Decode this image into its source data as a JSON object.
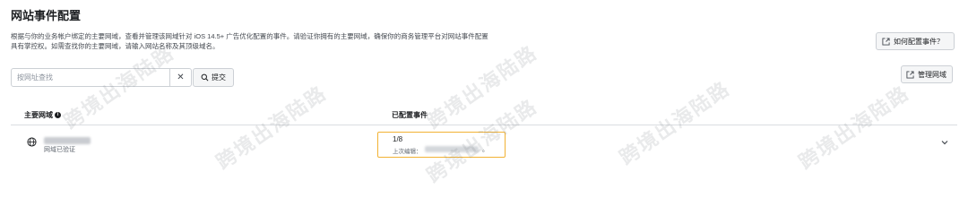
{
  "page": {
    "title": "网站事件配置",
    "description_line1": "根据与你的业务帐户绑定的主要网域，查看并管理该网域针对 iOS 14.5+ 广告优化配置的事件。请验证你拥有的主要网域，确保你的商务管理平台对网站事件配置",
    "description_line2": "具有掌控权。如需查找你的主要网域，请输入网站名称及其顶级域名。"
  },
  "buttons": {
    "howto_label": "如何配置事件？",
    "manage_label": "管理网域",
    "submit_label": "提交"
  },
  "search": {
    "placeholder": "按网址查找",
    "value": ""
  },
  "table": {
    "columns": [
      "主要网域",
      "已配置事件"
    ],
    "rows": [
      {
        "domain_status": "网域已验证",
        "events_count": "1/8",
        "last_edit_label": "上次编辑：",
        "last_edit_suffix": "。"
      }
    ]
  },
  "watermark": {
    "text": "跨境出海陆路"
  },
  "colors": {
    "highlight": "#f2b233",
    "border": "#ccd0d5",
    "watermark": "#787c82"
  }
}
